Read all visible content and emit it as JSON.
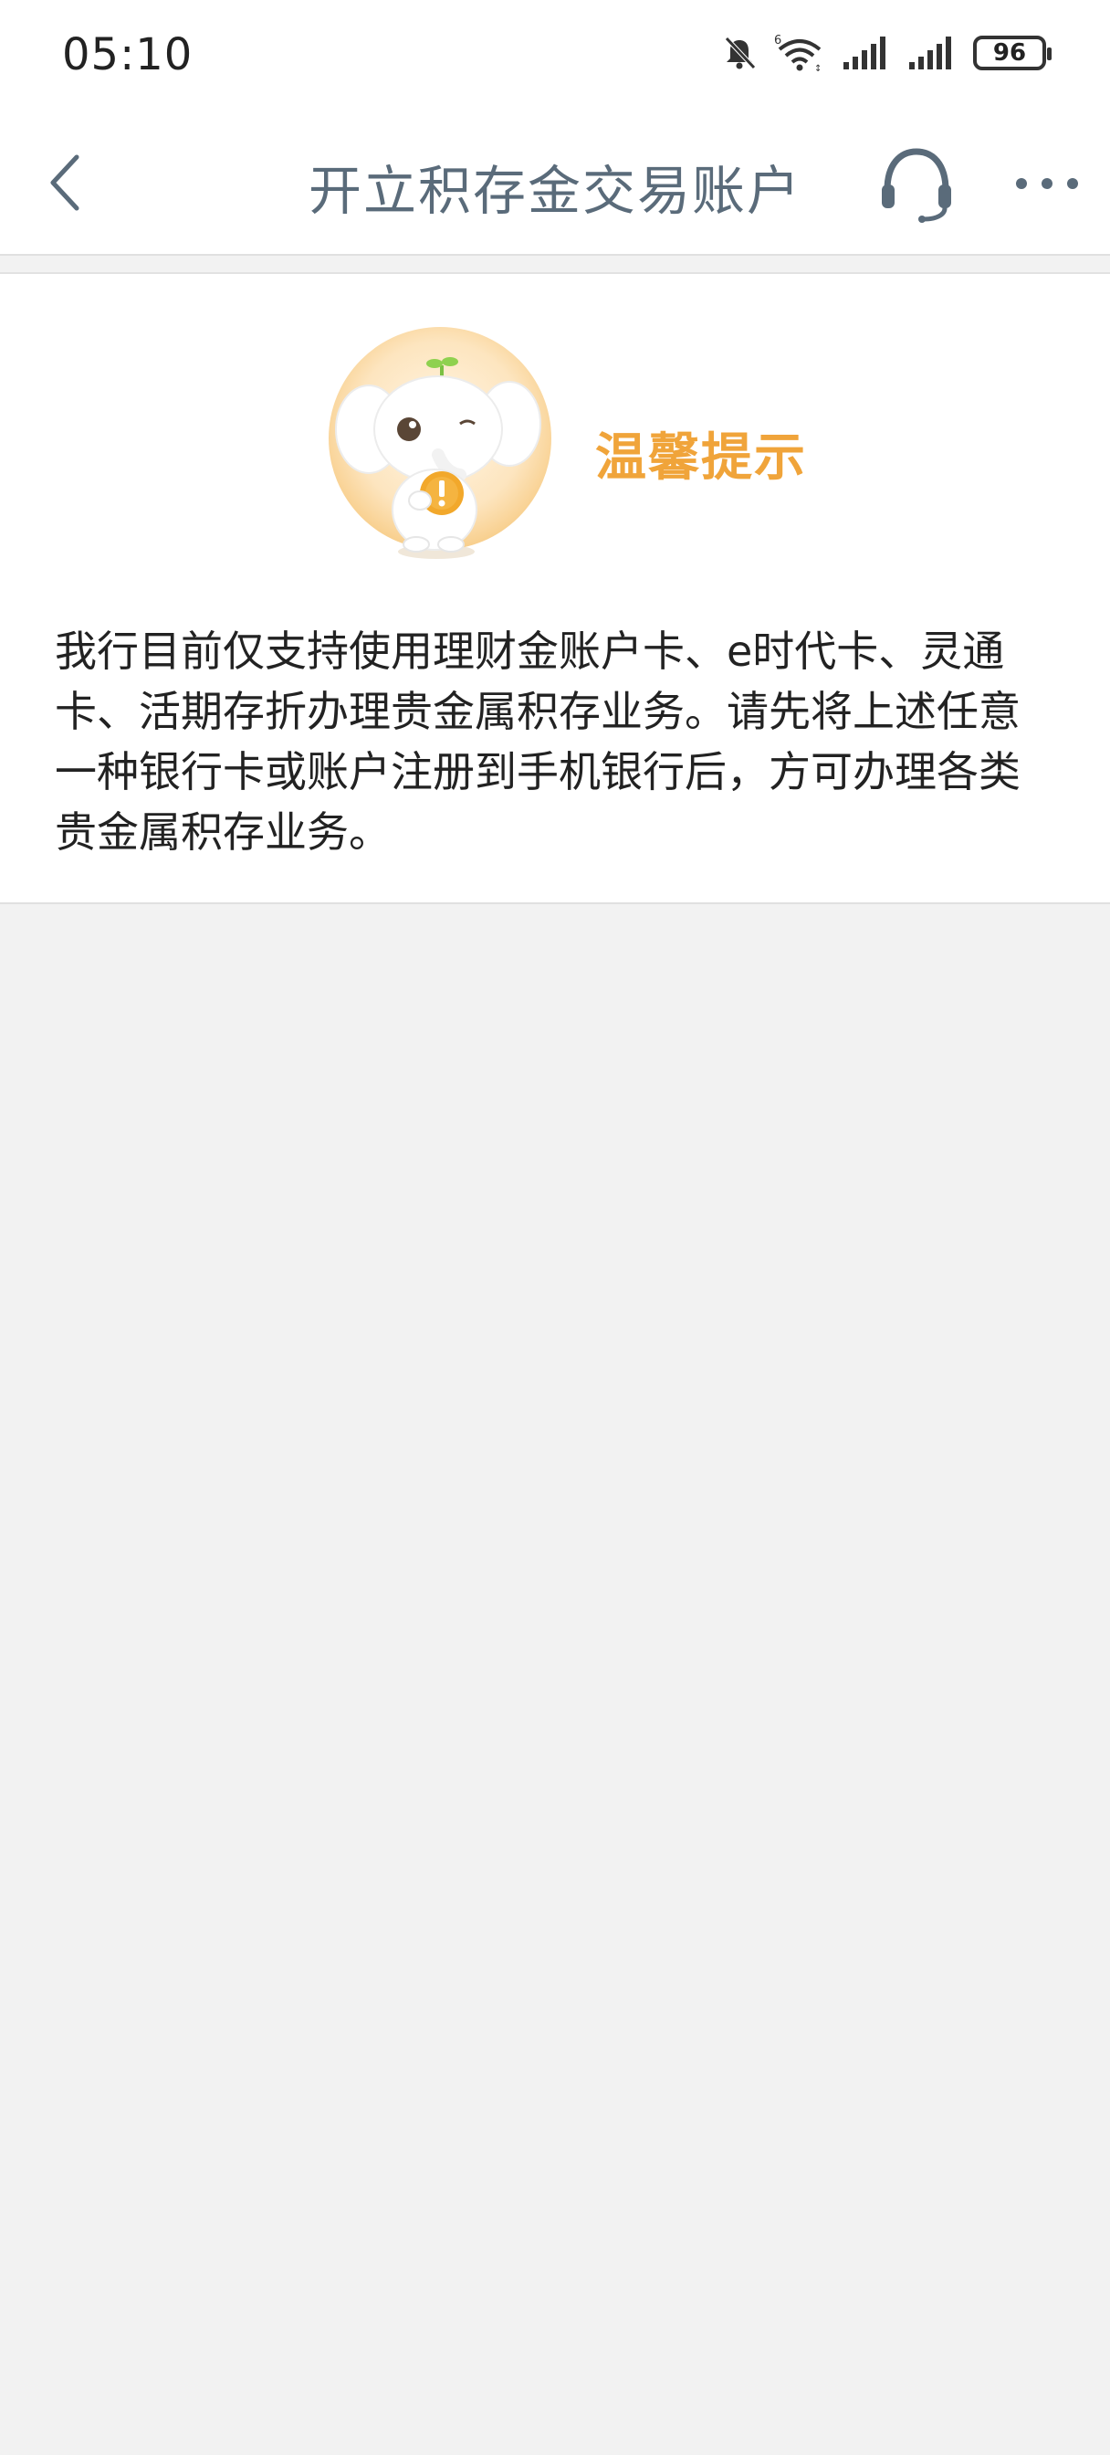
{
  "status_bar": {
    "time": "05:10",
    "battery": "96",
    "icons": [
      "bell-muted-icon",
      "wifi-icon",
      "signal-icon",
      "signal-icon",
      "battery-icon"
    ]
  },
  "nav": {
    "title": "开立积存金交易账户",
    "back_icon": "chevron-left-icon",
    "service_icon": "headset-icon",
    "more_icon": "more-icon",
    "title_color": "#5a6b7a"
  },
  "tip": {
    "heading": "温馨提示",
    "heading_color": "#f0a43a",
    "body": "我行目前仅支持使用理财金账户卡、e时代卡、灵通卡、活期存折办理贵金属积存业务。请先将上述任意一种银行卡或账户注册到手机银行后，方可办理各类贵金属积存业务。"
  },
  "colors": {
    "background": "#f2f2f2",
    "card": "#ffffff"
  }
}
